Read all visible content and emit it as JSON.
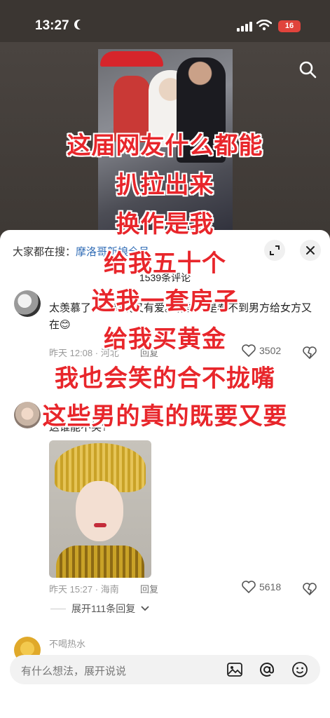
{
  "status_bar": {
    "time": "13:27",
    "battery": "16"
  },
  "sheet": {
    "search_prefix": "大家都在搜：",
    "search_term": "摩洛哥新娘",
    "search_suffix": "全员",
    "comment_count": "1539条评论"
  },
  "comments": [
    {
      "name": "",
      "text": "太羡慕了，又有钱又有爱。有些人是看不到男方给女方又在😊",
      "time_location": "昨天 12:08 · 河北",
      "reply_label": "回复",
      "likes": "3502"
    },
    {
      "name": "",
      "text": "这谁能不笑?",
      "time_location": "昨天 15:27 · 海南",
      "reply_label": "回复",
      "likes": "5618",
      "expand_replies": "展开111条回复"
    },
    {
      "name": "不喝热水"
    }
  ],
  "input": {
    "placeholder": "有什么想法，展开说说"
  },
  "overlay_lines": [
    "这届网友什么都能",
    "扒拉出来",
    "换作是我",
    "给我五十个",
    "送我一套房子",
    "给我买黄金",
    "我也会笑的合不拢嘴",
    "这些男的真的既要又要"
  ],
  "colors": {
    "accent_red": "#e8262b",
    "link_blue": "#2f6bb5",
    "battery_red": "#e0433c"
  },
  "icons": [
    "moon-icon",
    "signal-icon",
    "wifi-icon",
    "search-icon",
    "expand-icon",
    "close-icon",
    "heart-icon",
    "dislike-icon",
    "chevron-down-icon",
    "image-icon",
    "at-icon",
    "emoji-icon"
  ]
}
